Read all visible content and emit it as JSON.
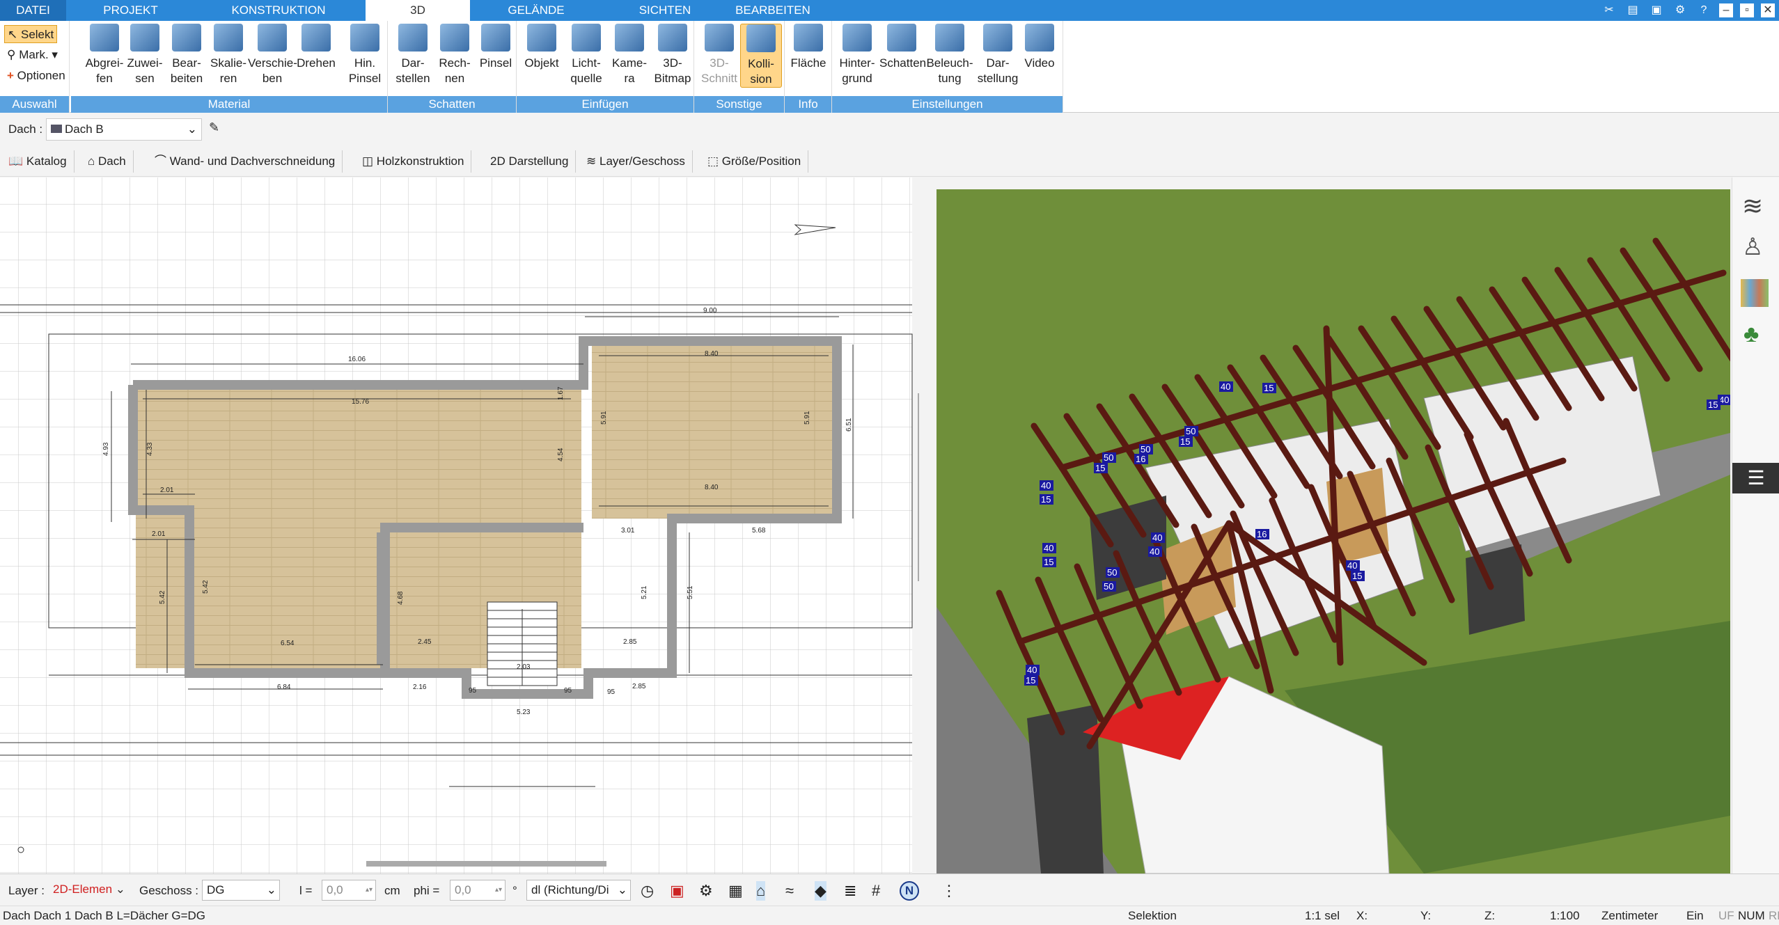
{
  "menu": {
    "tabs": [
      "DATEI",
      "PROJEKT",
      "KONSTRUKTION",
      "3D",
      "GELÄNDE",
      "SICHTEN",
      "BEARBEITEN"
    ]
  },
  "ribbon": {
    "auswahl": {
      "label": "Auswahl",
      "selekt": "Selekt",
      "mark": "Mark.",
      "optionen": "Optionen"
    },
    "material": {
      "label": "Material",
      "buttons": [
        [
          "Abgrei-",
          "fen"
        ],
        [
          "Zuwei-",
          "sen"
        ],
        [
          "Bear-",
          "beiten"
        ],
        [
          "Skalie-",
          "ren"
        ],
        [
          "Verschie-",
          "ben"
        ],
        [
          "Drehen",
          ""
        ],
        [
          "Hin.",
          "Pinsel"
        ]
      ]
    },
    "schatten": {
      "label": "Schatten",
      "buttons": [
        [
          "Dar-",
          "stellen"
        ],
        [
          "Rech-",
          "nen"
        ],
        [
          "Pinsel",
          ""
        ]
      ]
    },
    "einfuegen": {
      "label": "Einfügen",
      "buttons": [
        [
          "Objekt",
          ""
        ],
        [
          "Licht-",
          "quelle"
        ],
        [
          "Kame-",
          "ra"
        ],
        [
          "3D-",
          "Bitmap"
        ]
      ]
    },
    "sonstige": {
      "label": "Sonstige",
      "buttons": [
        [
          "3D-",
          "Schnitt"
        ],
        [
          "Kolli-",
          "sion"
        ]
      ]
    },
    "info": {
      "label": "Info",
      "buttons": [
        [
          "Fläche",
          ""
        ]
      ]
    },
    "einstellungen": {
      "label": "Einstellungen",
      "buttons": [
        [
          "Hinter-",
          "grund"
        ],
        [
          "Schatten",
          ""
        ],
        [
          "Beleuch-",
          "tung"
        ],
        [
          "Dar-",
          "stellung"
        ],
        [
          "Video",
          ""
        ]
      ]
    }
  },
  "propbar": {
    "label": "Dach :",
    "value": "Dach B"
  },
  "toolbar2": {
    "items": [
      "Katalog",
      "Dach",
      "Wand- und Dachverschneidung",
      "Holzkonstruktion",
      "2D Darstellung",
      "Layer/Geschoss",
      "Größe/Position"
    ]
  },
  "plan": {
    "dims": {
      "d900": "9.00",
      "d1606": "16.06",
      "d840a": "8.40",
      "d1576": "15.76",
      "d591a": "5.91",
      "d591b": "5.91",
      "d651": "6.51",
      "d433": "4.33",
      "d454": "4.54",
      "d493": "4.93",
      "d840b": "8.40",
      "d201a": "2.01",
      "d201b": "2.01",
      "d301": "3.01",
      "d568": "5.68",
      "d542a": "5.42",
      "d542b": "5.42",
      "d468": "4.68",
      "d521": "5.21",
      "d551": "5.51",
      "d654": "6.54",
      "d245": "2.45",
      "d285a": "2.85",
      "d203": "2.03",
      "d95a": "95",
      "d95b": "95",
      "d95c": "95",
      "d684": "6.84",
      "d216": "2.16",
      "d285b": "2.85",
      "d523": "5.23",
      "d167": "1.67"
    }
  },
  "view3d": {
    "labels": [
      "50",
      "15",
      "50",
      "16",
      "50",
      "15",
      "40",
      "15",
      "40",
      "15",
      "40",
      "15",
      "50",
      "50",
      "40",
      "40",
      "16",
      "40",
      "15",
      "40",
      "15",
      "40",
      "15"
    ]
  },
  "bottombar": {
    "layer_label": "Layer :",
    "layer_value": "2D-Elemen",
    "geschoss_label": "Geschoss :",
    "geschoss_value": "DG",
    "l_label": "l =",
    "l_value": "0,0",
    "l_unit": "cm",
    "phi_label": "phi =",
    "phi_value": "0,0",
    "phi_unit": "°",
    "dl_value": "dl (Richtung/Di"
  },
  "status": {
    "left": "Dach Dach 1 Dach B L=Dächer G=DG",
    "selektion": "Selektion",
    "sel": "1:1 sel",
    "x": "X:",
    "y": "Y:",
    "z": "Z:",
    "scale": "1:100",
    "unit": "Zentimeter",
    "ein": "Ein",
    "uf": "UF",
    "num": "NUM",
    "rf": "RF"
  },
  "colors": {
    "accent": "#2b88d8",
    "group": "#5aa2e0",
    "selected": "#ffd68a",
    "wall": "#9a9a9a",
    "floor": "#d8c49a",
    "grass": "#6f8f3a",
    "beam": "#5a1a12",
    "dim_blue": "#1a1aa0"
  }
}
